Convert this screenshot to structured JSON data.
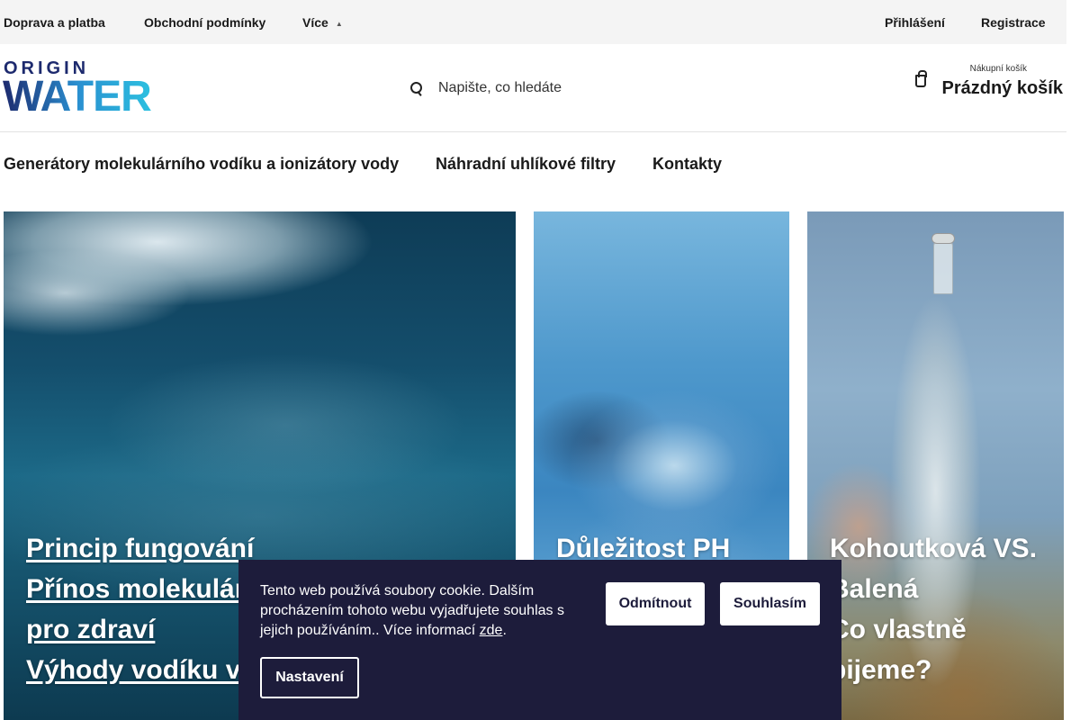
{
  "topbar": {
    "links": [
      "Doprava a platba",
      "Obchodní podmínky",
      "Více"
    ],
    "more_chevron": "▲",
    "login": "Přihlášení",
    "register": "Registrace"
  },
  "header": {
    "logo": {
      "line1": "ORIGIN",
      "line2": "WATER"
    },
    "search": {
      "placeholder": "Napište, co hledáte",
      "icon": "search-icon"
    },
    "cart": {
      "label_small": "Nákupní košík",
      "label_main": "Prázdný košík",
      "icon": "bag-icon"
    }
  },
  "nav": {
    "items": [
      "Generátory molekulárního vodíku a ionizátory vody",
      "Náhradní uhlíkové filtry",
      "Kontakty"
    ]
  },
  "cards": [
    {
      "lines": [
        "Princip fungování",
        "Přínos molekulárního vodíku",
        "pro zdraví",
        "Výhody vodíku v"
      ]
    },
    {
      "lines": [
        "Důležitost PH"
      ]
    },
    {
      "lines": [
        "Kohoutková VS.",
        "Balená",
        "Co vlastně",
        "pijeme?"
      ]
    }
  ],
  "cookie": {
    "text_before": "Tento web používá soubory cookie. Dalším procházením tohoto webu vyjadřujete souhlas s jejich používáním.. Více informací ",
    "link": "zde",
    "text_after": ".",
    "reject": "Odmítnout",
    "accept": "Souhlasím",
    "settings": "Nastavení"
  },
  "colors": {
    "banner_bg": "#1d1c3b",
    "logo_dark": "#1d2a6e",
    "logo_cyan": "#2cc0e0",
    "topbar_bg": "#f4f4f4"
  }
}
